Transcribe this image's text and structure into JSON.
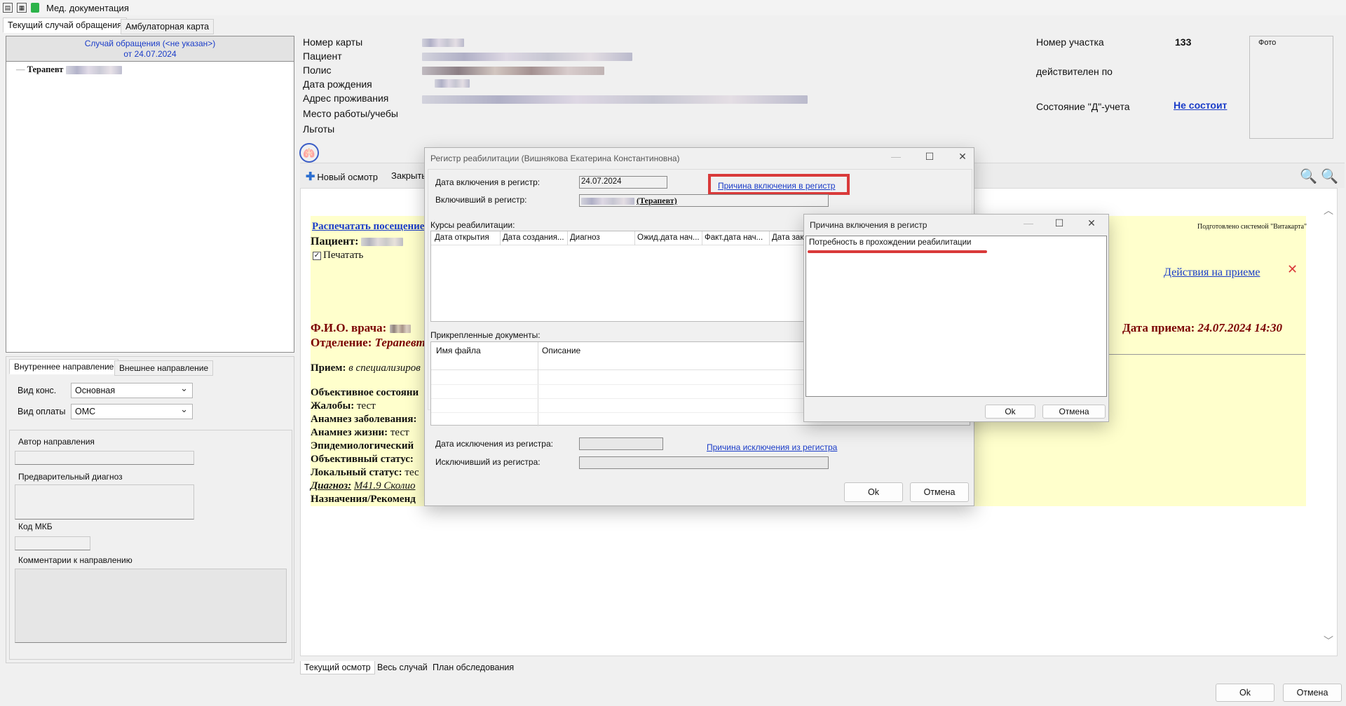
{
  "app": {
    "title": "Мед. документация"
  },
  "top_tabs": [
    "Текущий случай обращения",
    "Амбулаторная карта"
  ],
  "case": {
    "line1": "Случай обращения (<не указан>)",
    "line2": "от 24.07.2024"
  },
  "tree": {
    "item": "Терапевт"
  },
  "referral_tabs": [
    "Внутреннее направление",
    "Внешнее направление"
  ],
  "referral": {
    "vid_kons_label": "Вид конс.",
    "vid_kons_value": "Основная",
    "vid_oplaty_label": "Вид оплаты",
    "vid_oplaty_value": "ОМС",
    "author_label": "Автор направления",
    "prelim_diag_label": "Предварительный диагноз",
    "mkb_label": "Код МКБ",
    "comment_label": "Комментарии к направлению"
  },
  "patient_labels": [
    "Номер карты",
    "Пациент",
    "Полис",
    "Дата рождения",
    "Адрес проживания",
    "Место работы/учебы",
    "Льготы"
  ],
  "right_info": {
    "uchastok_label": "Номер участка",
    "uchastok_value": "133",
    "valid_label": "действителен по",
    "d_label": "Состояние \"Д\"-учета",
    "d_value": "Не состоит",
    "photo_label": "Фото"
  },
  "toolbar": {
    "new_exam": "Новый осмотр",
    "close": "Закрыть"
  },
  "doc": {
    "print_link": "Распечатать посещение",
    "patient_label": "Пациент:",
    "print_check": "Печатать",
    "system_note": "Подготовлено системой \"Витакарта\"",
    "actions_link": "Действия на приеме",
    "doctor_label": "Ф.И.О. врача:",
    "dept_label": "Отделение:",
    "dept_value": "Терапевт",
    "visit_date_label": "Дата приема:",
    "visit_date_value": "24.07.2024 14:30",
    "priem_label": "Прием:",
    "priem_value": "в специализиров",
    "obj_state": "Объективное состояни",
    "complaints_label": "Жалобы:",
    "complaints_value": "тест",
    "anamnez_zab": "Анамнез заболевания:",
    "anamnez_life_label": "Анамнез жизни:",
    "anamnez_life_value": "тест",
    "epid": "Эпидемиологический",
    "obj_status": "Объективный статус:",
    "local_status_label": "Локальный статус:",
    "local_status_value": "тес",
    "diagnosis_label": "Диагноз:",
    "diagnosis_value": "M41.9 Сколио",
    "naznach": "Назначения/Рекоменд"
  },
  "bottom_tabs": [
    "Текущий осмотр",
    "Весь случай",
    "План обследования"
  ],
  "main_buttons": {
    "ok": "Ok",
    "cancel": "Отмена"
  },
  "registry_dialog": {
    "title": "Регистр реабилитации (Вишнякова Екатерина Константиновна)",
    "incl_date_label": "Дата включения в регистр:",
    "incl_date_value": "24.07.2024",
    "incl_reason_link": "Причина включения в регистр",
    "included_by_label": "Включивший в регистр:",
    "included_by_value": "(Терапевт)",
    "courses_label": "Курсы реабилитации:",
    "courses_cols": [
      "Дата открытия",
      "Дата создания...",
      "Диагноз",
      "Ожид.дата нач...",
      "Факт.дата нач...",
      "Дата зак"
    ],
    "docs_label": "Прикрепленные документы:",
    "docs_cols": [
      "Имя файла",
      "Описание"
    ],
    "excl_date_label": "Дата исключения из регистра:",
    "excl_reason_link": "Причина исключения из регистра",
    "excluded_by_label": "Исключивший из регистра:",
    "ok": "Ok",
    "cancel": "Отмена"
  },
  "reason_dialog": {
    "title": "Причина включения в регистр",
    "text": "Потребность в прохождении реабилитации",
    "ok": "Ok",
    "cancel": "Отмена"
  },
  "colors": {
    "highlight": "#d93a3a",
    "link": "#1a3cc8",
    "maroon": "#7a0000",
    "doc_bg": "#ffffcc"
  }
}
